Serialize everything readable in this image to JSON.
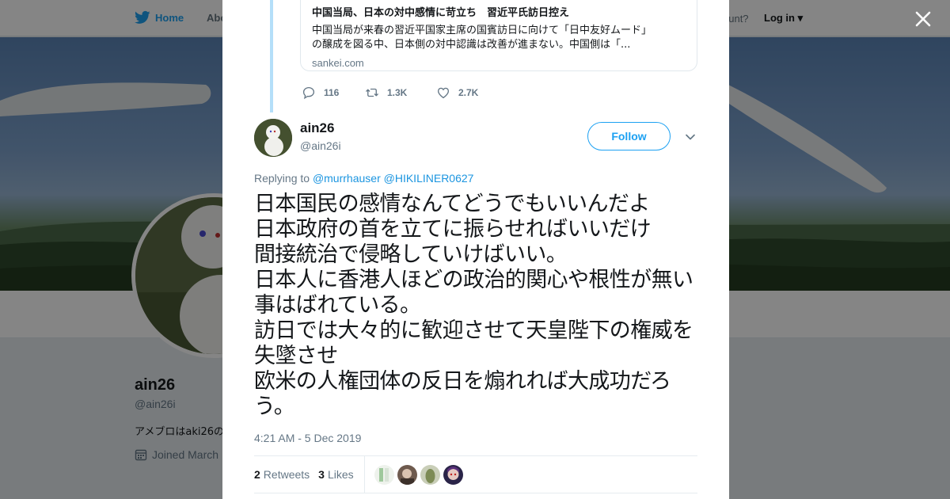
{
  "background_page": {
    "nav": {
      "home": "Home",
      "about": "Abo",
      "account_prompt": "ccount?",
      "login": "Log in"
    },
    "profile": {
      "name": "ain26",
      "handle": "@ain26i",
      "bio": "アメブロはaki26の",
      "joined": "Joined March"
    }
  },
  "quoted_card": {
    "title": "中国当局、日本の対中感情に苛立ち　習近平氏訪日控え",
    "description_line1": "中国当局が来春の習近平国家主席の国賓訪日に向けて「日中友好ムード」",
    "description_line2": "の醸成を図る中、日本側の対中認識は改善が進まない。中国側は「...",
    "domain": "sankei.com"
  },
  "quoted_actions": {
    "replies": "116",
    "retweets": "1.3K",
    "likes": "2.7K"
  },
  "tweet": {
    "author_name": "ain26",
    "author_handle": "@ain26i",
    "follow_label": "Follow",
    "replying_prefix": "Replying to",
    "replying_to": [
      "@murrhauser",
      "@HIKILINER0627"
    ],
    "text": "日本国民の感情なんてどうでもいいんだよ\n日本政府の首を立てに振らせればいいだけ\n間接統治で侵略していけばいい。\n日本人に香港人ほどの政治的関心や根性が無い事はばれている。\n訪日では大々的に歓迎させて天皇陛下の権威を失墜させ\n欧米の人権団体の反日を煽れれば大成功だろう。",
    "timestamp": "4:21 AM - 5 Dec 2019",
    "retweets_count": "2",
    "retweets_label": "Retweets",
    "likes_count": "3",
    "likes_label": "Likes"
  },
  "colors": {
    "accent": "#1da1f2",
    "link": "#1b95e0",
    "muted": "#657786",
    "text": "#14171a"
  },
  "icons": [
    "twitter-bird-icon",
    "close-icon",
    "reply-icon",
    "retweet-icon",
    "heart-icon",
    "chevron-down-icon",
    "calendar-icon"
  ]
}
